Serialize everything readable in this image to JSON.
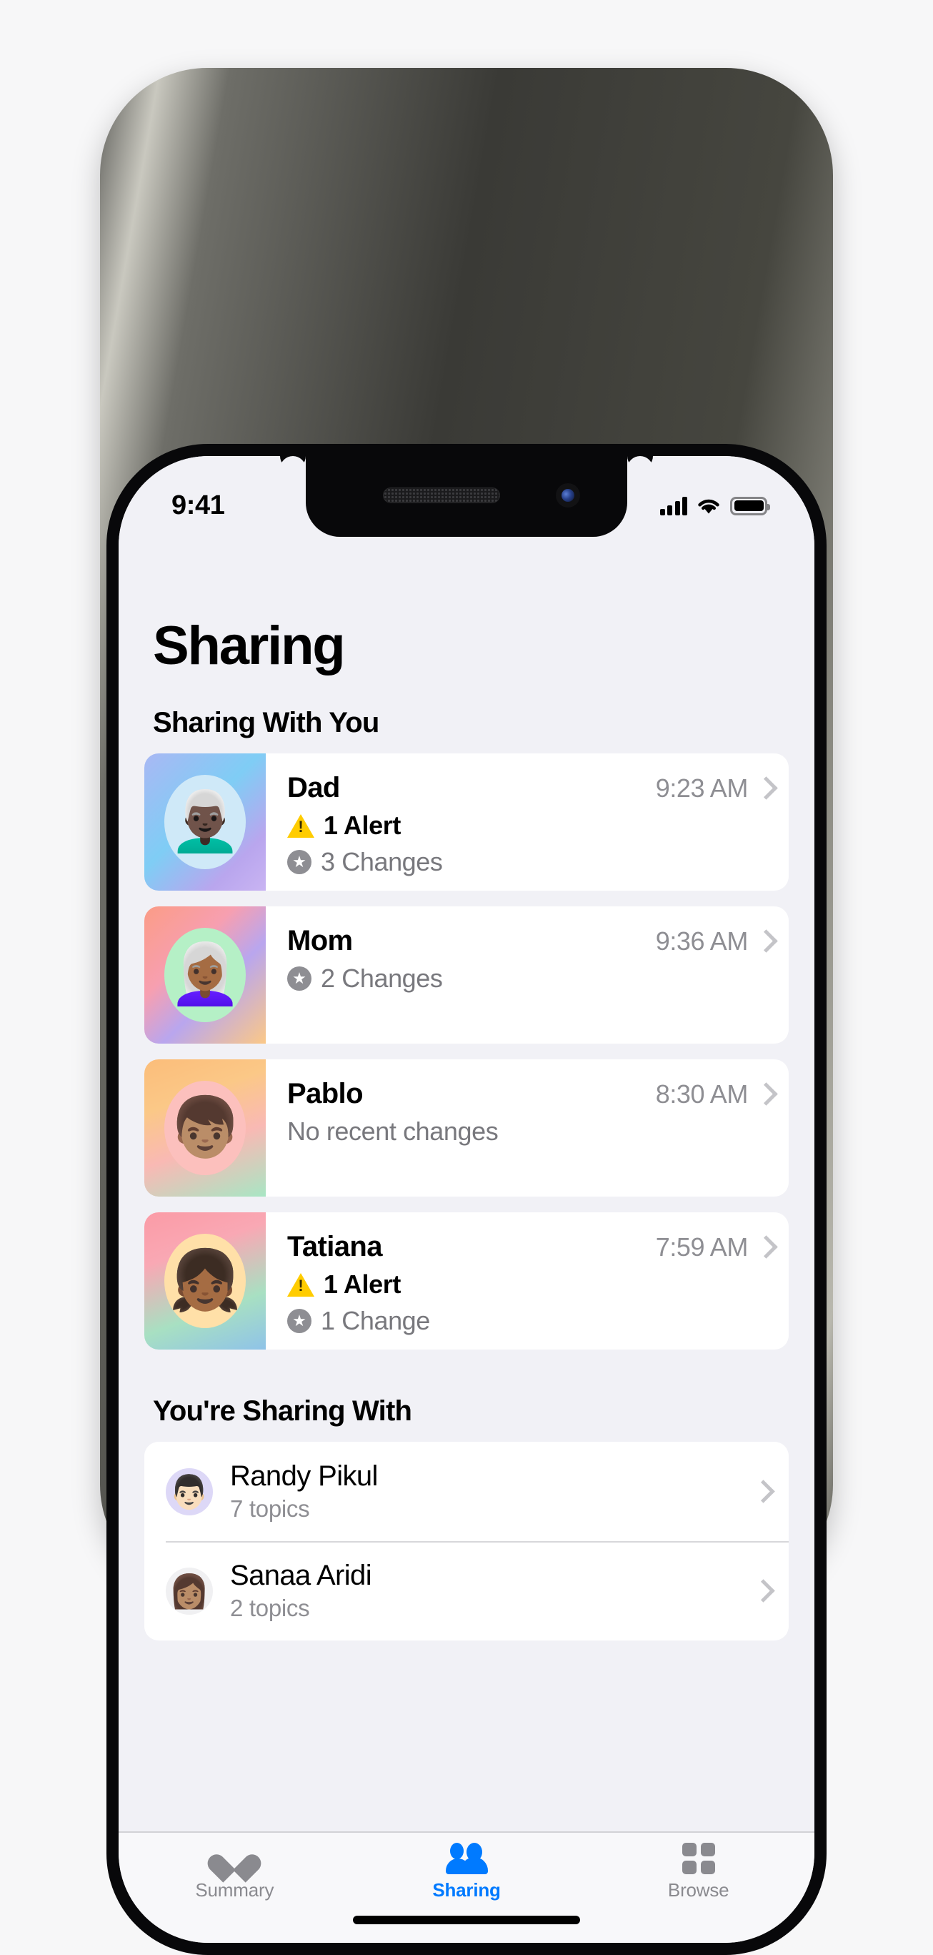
{
  "status_bar": {
    "time": "9:41",
    "cellular_icon": "cellular-signal-icon",
    "wifi_icon": "wifi-icon",
    "battery_icon": "battery-icon"
  },
  "page": {
    "title": "Sharing"
  },
  "sections": {
    "sharing_with_you": {
      "header": "Sharing With You",
      "items": [
        {
          "name": "Dad",
          "time": "9:23 AM",
          "alert": "1 Alert",
          "changes": "3 Changes",
          "memoji": "👨🏿‍🦳",
          "tile_gradient": "linear-gradient(135deg,#a9b8f4 0%,#7fcdf5 45%,#b9a6ee 78%,#c9b4f2 100%)",
          "ring_color": "#cfe9f8"
        },
        {
          "name": "Mom",
          "time": "9:36 AM",
          "alert": "",
          "changes": "2 Changes",
          "memoji": "👩🏾‍🦳",
          "tile_gradient": "linear-gradient(135deg,#fb9c86 0%,#f79fb0 35%,#b9a6ee 60%,#fbc887 100%)",
          "ring_color": "#b5f0c6"
        },
        {
          "name": "Pablo",
          "time": "8:30 AM",
          "alert": "",
          "changes": "No recent changes",
          "memoji": "👦🏽",
          "tile_gradient": "linear-gradient(160deg,#fbbd7a 0%,#fbc887 30%,#f9b9b4 60%,#a8e6c4 100%)",
          "ring_color": "#fcc0bd"
        },
        {
          "name": "Tatiana",
          "time": "7:59 AM",
          "alert": "1 Alert",
          "changes": "1 Change",
          "memoji": "👧🏾",
          "tile_gradient": "linear-gradient(160deg,#fb9ba6 0%,#f9a8b4 30%,#a8e0c2 68%,#8fc3e8 100%)",
          "ring_color": "#ffe0a8"
        }
      ]
    },
    "youre_sharing_with": {
      "header": "You're Sharing With",
      "items": [
        {
          "name": "Randy Pikul",
          "sub": "7 topics",
          "memoji": "👨🏻",
          "bg": "#ddd8f7"
        },
        {
          "name": "Sanaa Aridi",
          "sub": "2 topics",
          "memoji": "👩🏽",
          "bg": "#f0f0f2"
        }
      ]
    }
  },
  "tab_bar": {
    "tabs": [
      {
        "label": "Summary",
        "icon": "heart-icon",
        "active": false
      },
      {
        "label": "Sharing",
        "icon": "people-icon",
        "active": true
      },
      {
        "label": "Browse",
        "icon": "grid-icon",
        "active": false
      }
    ]
  },
  "colors": {
    "accent": "#007aff",
    "alert_yellow": "#ffcc00",
    "secondary_text": "#8e8e93",
    "page_background": "#f1f1f6",
    "card_background": "#ffffff"
  }
}
